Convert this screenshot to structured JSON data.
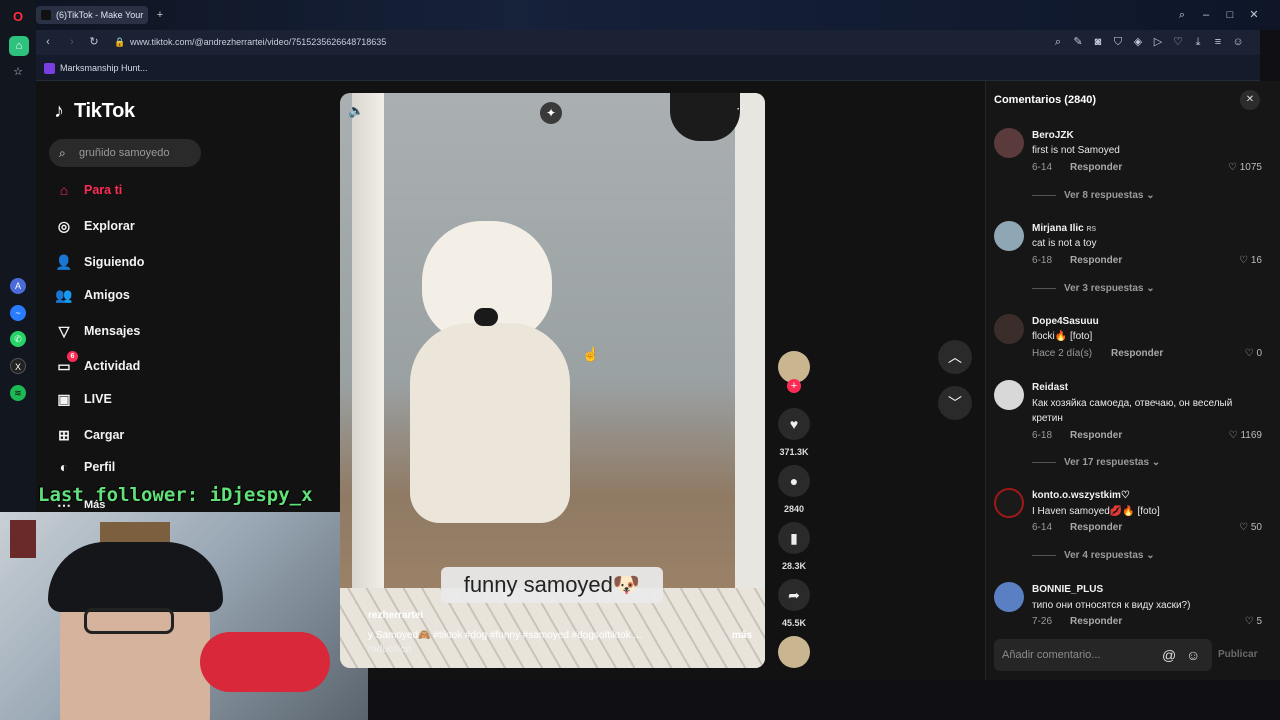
{
  "browser": {
    "tab_title": "(6)TikTok - Make Your",
    "url": "www.tiktok.com/@andrezherrartei/video/7515235626648718635",
    "bookmark": "Marksmanship Hunt..."
  },
  "sidebar": {
    "logo": "TikTok",
    "search_placeholder": "gruñido samoyedo",
    "items": [
      {
        "label": "Para ti",
        "icon": "home-icon"
      },
      {
        "label": "Explorar",
        "icon": "compass-icon"
      },
      {
        "label": "Siguiendo",
        "icon": "following-icon"
      },
      {
        "label": "Amigos",
        "icon": "friends-icon"
      },
      {
        "label": "Mensajes",
        "icon": "messages-icon"
      },
      {
        "label": "Actividad",
        "icon": "activity-icon",
        "badge": "6"
      },
      {
        "label": "LIVE",
        "icon": "live-icon"
      },
      {
        "label": "Cargar",
        "icon": "upload-icon"
      },
      {
        "label": "Perfil",
        "icon": "profile-icon"
      },
      {
        "label": "Más",
        "icon": "more-icon"
      }
    ]
  },
  "stream_overlay": "Last follower: iDjespy_x",
  "video": {
    "caption": "funny samoyed🐶",
    "username": "rezherrartei",
    "description": "y Samoyed🙈 #tiktok #dog #funny #samoyed #dogsoftiktok ...",
    "more": "más",
    "translation": "raducción",
    "likes": "371.3K",
    "comments": "2840",
    "saves": "28.3K",
    "shares": "45.5K"
  },
  "comments_panel": {
    "title": "Comentarios (2840)",
    "input_placeholder": "Añadir comentario...",
    "post_label": "Publicar",
    "reply_label": "Responder",
    "comments": [
      {
        "user": "BeroJZK",
        "text": "first is not Samoyed",
        "date": "6-14",
        "likes": "1075",
        "replies": "Ver 8 respuestas"
      },
      {
        "user": "Mirjana Ilic",
        "flag": "RS",
        "text": "cat is not a toy",
        "date": "6-18",
        "likes": "16",
        "replies": "Ver 3 respuestas"
      },
      {
        "user": "Dope4Sasuuu",
        "text": "flocki🔥 [foto]",
        "date": "Hace 2 día(s)",
        "likes": "0"
      },
      {
        "user": "Reidast",
        "text": "Как хозяйка самоеда, отвечаю, он веселый кретин",
        "date": "6-18",
        "likes": "1169",
        "replies": "Ver 17 respuestas"
      },
      {
        "user": "konto.o.wszystkim♡",
        "text": "I Haven samoyed💋🔥 [foto]",
        "date": "6-14",
        "likes": "50",
        "replies": "Ver 4 respuestas"
      },
      {
        "user": "BONNIE_PLUS",
        "text": "типо они относятся к виду хаски?)",
        "date": "7-26",
        "likes": "5"
      }
    ]
  },
  "colors": {
    "accent": "#fe2c55",
    "overlay_green": "#62e07a"
  }
}
